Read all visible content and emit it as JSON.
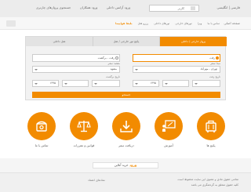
{
  "topbar": {
    "lang": "فارسی | انگلیسی",
    "account_label": "کاربر",
    "links": [
      "ورود آژانس داخلی",
      "ورود همکاران",
      "جستجوی پروازهای چارتری"
    ]
  },
  "menu": {
    "home": "صفحه اصلی",
    "items": [
      "بلیط هواپیما",
      "رزرو هتل",
      "تورهای داخلی",
      "تورهای خارجی",
      "ویزا",
      "تماس با ما"
    ],
    "active_index": 0
  },
  "search_panel": {
    "tabs": [
      "پرواز خارجی / داخلی",
      "پکیج تور خارجی / هتل",
      "هتل داخلی"
    ],
    "active_tab": 0,
    "trip_type": {
      "oneway": "رفت",
      "roundtrip": "رفت - برگشت",
      "selected": "oneway"
    },
    "origin": {
      "label": "مبدا سفر",
      "value": "تهران - مهرآباد"
    },
    "destination": {
      "label": "مقصد سفر",
      "value": "مشهد"
    },
    "dates": [
      {
        "label": "تاریخ رفت",
        "day": "",
        "month": "",
        "year": "۱۳۹۵"
      },
      {
        "label": "تاریخ برگشت",
        "day": "",
        "month": "",
        "year": "۱۳۹۵"
      }
    ],
    "search_label": "جستجو"
  },
  "services": [
    {
      "icon": "luggage-icon",
      "label": "پکیج ها"
    },
    {
      "icon": "classroom-icon",
      "label": "آموزش"
    },
    {
      "icon": "download-icon",
      "label": "دریافت سفر"
    },
    {
      "icon": "scales-icon",
      "label": "قوانین و مقررات"
    },
    {
      "icon": "phone-icon",
      "label": "تماس با ما"
    }
  ],
  "login": {
    "label": "خرید آنلاین",
    "prefix": "ورود"
  },
  "footer": {
    "line1": "تمامی حقوق مادی و معنوی این سایت محفوظ است",
    "line2": "کلیه حقوق متعلق به گردشگری می باشد",
    "dot_link": "نمادهای اعتماد"
  },
  "colors": {
    "accent": "#f28b00",
    "topbar": "#ececec",
    "panel": "#f2f2f2"
  }
}
